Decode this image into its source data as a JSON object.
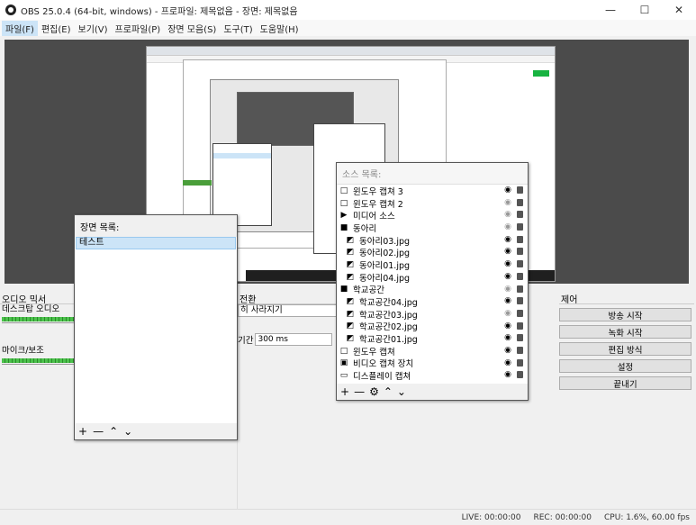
{
  "window": {
    "title": "OBS 25.0.4 (64-bit, windows) - 프로파일: 제목없음 - 장면: 제목없음"
  },
  "menu": [
    {
      "label": "파일(F)"
    },
    {
      "label": "편집(E)"
    },
    {
      "label": "보기(V)"
    },
    {
      "label": "프로파일(P)"
    },
    {
      "label": "장면 모음(S)"
    },
    {
      "label": "도구(T)"
    },
    {
      "label": "도움말(H)"
    }
  ],
  "scenes": {
    "header": "장면 목록:",
    "items": [
      "테스트"
    ]
  },
  "sources": {
    "header": "소스 목록:",
    "items": [
      {
        "label": "윈도우 캡쳐 3",
        "icon": "window-icon",
        "visible": true
      },
      {
        "label": "윈도우 캡쳐 2",
        "icon": "window-icon",
        "visible": false
      },
      {
        "label": "미디어 소스",
        "icon": "play-icon",
        "visible": false
      },
      {
        "label": "동아리",
        "icon": "folder-icon",
        "visible": false,
        "group": true
      },
      {
        "label": "동아리03.jpg",
        "icon": "image-icon",
        "visible": true
      },
      {
        "label": "동아리02.jpg",
        "icon": "image-icon",
        "visible": true
      },
      {
        "label": "동아리01.jpg",
        "icon": "image-icon",
        "visible": true
      },
      {
        "label": "동아리04.jpg",
        "icon": "image-icon",
        "visible": true
      },
      {
        "label": "학교공간",
        "icon": "folder-icon",
        "visible": false,
        "group": true
      },
      {
        "label": "학교공간04.jpg",
        "icon": "image-icon",
        "visible": true
      },
      {
        "label": "학교공간03.jpg",
        "icon": "image-icon",
        "visible": false
      },
      {
        "label": "학교공간02.jpg",
        "icon": "image-icon",
        "visible": true
      },
      {
        "label": "학교공간01.jpg",
        "icon": "image-icon",
        "visible": true
      },
      {
        "label": "윈도우 캡쳐",
        "icon": "window-icon",
        "visible": true
      },
      {
        "label": "비디오 캡쳐 장치",
        "icon": "camera-icon",
        "visible": true
      },
      {
        "label": "디스플레이 캡쳐",
        "icon": "monitor-icon",
        "visible": true
      }
    ]
  },
  "mixer": {
    "title": "오디오 믹서",
    "channels": [
      "데스크탑 오디오",
      "마이크/보조"
    ]
  },
  "transitions": {
    "title": "전환",
    "selected": "히 사라지기",
    "duration_label": "기간",
    "duration_value": "300 ms"
  },
  "controls": {
    "title": "제어",
    "buttons": [
      "방송 시작",
      "녹화 시작",
      "편집 방식",
      "설정",
      "끝내기"
    ]
  },
  "status": {
    "live": "LIVE: 00:00:00",
    "rec": "REC: 00:00:00",
    "cpu": "CPU: 1.6%, 60.00 fps"
  }
}
